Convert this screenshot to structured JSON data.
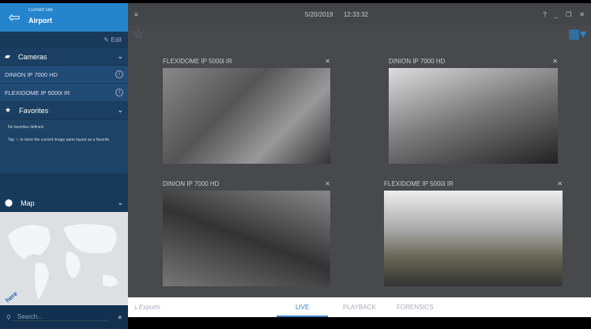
{
  "sidebar": {
    "site_caption": "Current site",
    "site_name": "Airport",
    "edit": "Edit",
    "cameras_label": "Cameras",
    "cameras": [
      "DINION IP 7000 HD",
      "FLEXIDOME IP 5000i IR"
    ],
    "favorites_label": "Favorites",
    "no_favorites": "No favorites defined.",
    "favorites_hint_pre": "Tap",
    "favorites_hint_post": "to store the current image pane layout as a favorite.",
    "map_label": "Map",
    "map_link": "here",
    "search_placeholder": "Search..."
  },
  "header": {
    "date": "5/20/2019",
    "time": "12:33:32"
  },
  "tiles": [
    {
      "name": "FLEXIDOME IP 5000i IR"
    },
    {
      "name": "DINION IP 7000 HD"
    },
    {
      "name": "DINION IP 7000 HD"
    },
    {
      "name": "FLEXIDOME IP 5000i IR"
    }
  ],
  "bottom": {
    "exports": "Exports",
    "tabs": [
      "LIVE",
      "PLAYBACK",
      "FORENSICS"
    ]
  },
  "colors": {
    "accent": "#2585cc",
    "sidebar": "#17395a",
    "main": "#47494d"
  }
}
